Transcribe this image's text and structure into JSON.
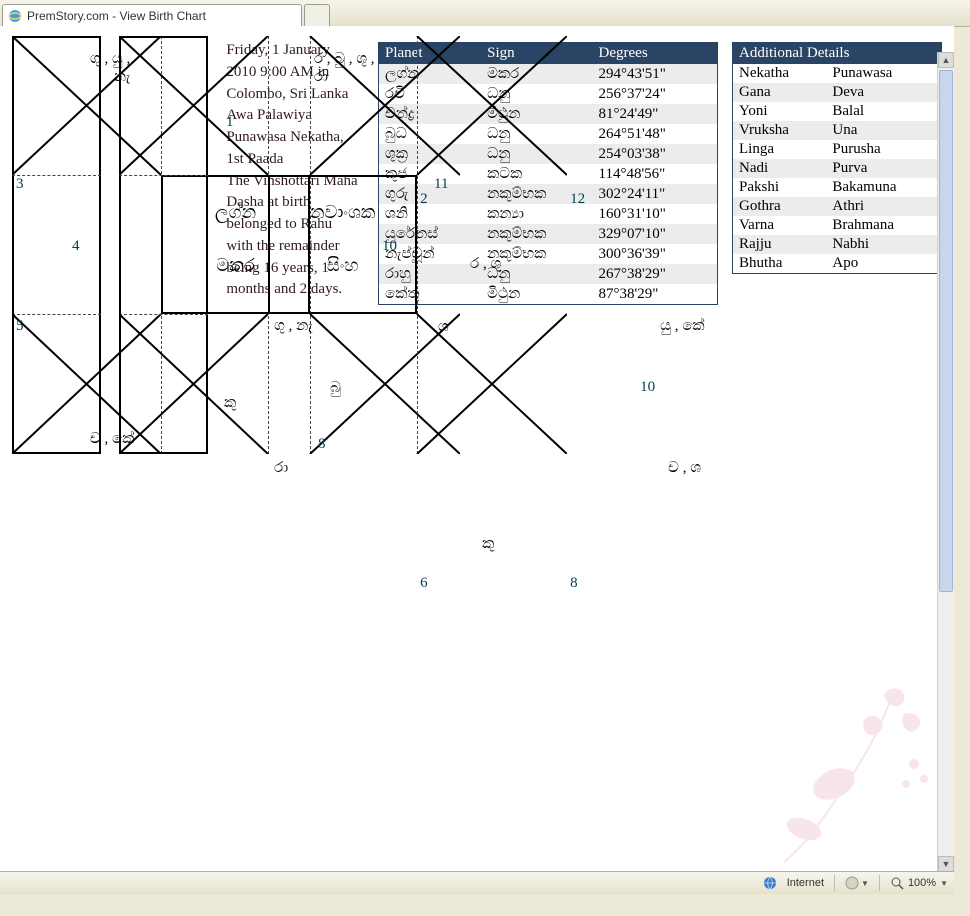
{
  "window": {
    "tab_title": "PremStory.com - View Birth Chart",
    "status_internet": "Internet",
    "status_zoom": "100%"
  },
  "charts": {
    "left": {
      "center_title_top": "ලග්න",
      "center_title_bottom": "මකර",
      "house_top_center": "1",
      "house_left_upper": "3",
      "house_left_mid": "4",
      "house_left_lower": "5",
      "house_bottom_left_corner": "",
      "house_bottom_center": "8",
      "house_right_lower": "",
      "house_right_mid": "10",
      "house_right_upper": "11",
      "labels": {
        "top_left": "ගු , යු ,\nනැ",
        "top_right": "ර , බු , ශු ,\nරා",
        "left_bottom_corner": "ච , කේ",
        "bottom_center": "කු",
        "right_upper_corner": "ශ"
      }
    },
    "right": {
      "center_title_top": "නවාංශක",
      "center_title_bottom": "සිංහ",
      "house_top_left_corner": "2",
      "house_top_right_corner": "12",
      "house_bottom_left_corner_num": "6",
      "house_bottom_center_num": "8",
      "house_right_mid": "10",
      "labels": {
        "top_center": "ර , ශු",
        "left_upper": "ගු , නැ",
        "right_upper": "යු , කේ",
        "left_mid": "බු",
        "left_lower": "රා",
        "bottom_center": "කු",
        "right_lower": "ච , ශ"
      }
    }
  },
  "info": {
    "line1": "Friday, 1 January 2010 9:00 AM in Colombo, Sri Lanka",
    "line2": "Awa Palawiya",
    "line3": "Punawasa Nekatha, 1st Paada",
    "line4": "The Vinshottari Maha Dasha at birth belonged to Rahu with the remainder being 16 years, 1 months and 2 days."
  },
  "planet_table": {
    "headers": {
      "c1": "Planet",
      "c2": "Sign",
      "c3": "Degrees"
    },
    "rows": [
      {
        "c1": "ලග්න",
        "c2": "මකර",
        "c3": "294°43'51\""
      },
      {
        "c1": "රවි",
        "c2": "ධනු",
        "c3": "256°37'24\""
      },
      {
        "c1": "චන්ද්‍ර",
        "c2": "මිථුන",
        "c3": "81°24'49\""
      },
      {
        "c1": "බුධ",
        "c2": "ධනු",
        "c3": "264°51'48\""
      },
      {
        "c1": "ශුක්‍ර",
        "c2": "ධනු",
        "c3": "254°03'38\""
      },
      {
        "c1": "කුජ",
        "c2": "කටක",
        "c3": "114°48'56\""
      },
      {
        "c1": "ගුරු",
        "c2": "නකුම්භක",
        "c3": "302°24'11\""
      },
      {
        "c1": "ශනි",
        "c2": "කන්‍යා",
        "c3": "160°31'10\""
      },
      {
        "c1": "යුරේනස්",
        "c2": "නකුම්භක",
        "c3": "329°07'10\""
      },
      {
        "c1": "නැප්චූන්",
        "c2": "නකුම්භක",
        "c3": "300°36'39\""
      },
      {
        "c1": "රාහු",
        "c2": "ධනු",
        "c3": "267°38'29\""
      },
      {
        "c1": "කේතු",
        "c2": "මිථුන",
        "c3": "87°38'29\""
      }
    ]
  },
  "details_table": {
    "header": "Additional Details",
    "rows": [
      {
        "k": "Nekatha",
        "v": "Punawasa"
      },
      {
        "k": "Gana",
        "v": "Deva"
      },
      {
        "k": "Yoni",
        "v": "Balal"
      },
      {
        "k": "Vruksha",
        "v": "Una"
      },
      {
        "k": "Linga",
        "v": "Purusha"
      },
      {
        "k": "Nadi",
        "v": "Purva"
      },
      {
        "k": "Pakshi",
        "v": "Bakamuna"
      },
      {
        "k": "Gothra",
        "v": "Athri"
      },
      {
        "k": "Varna",
        "v": "Brahmana"
      },
      {
        "k": "Rajju",
        "v": "Nabhi"
      },
      {
        "k": "Bhutha",
        "v": "Apo"
      }
    ]
  }
}
